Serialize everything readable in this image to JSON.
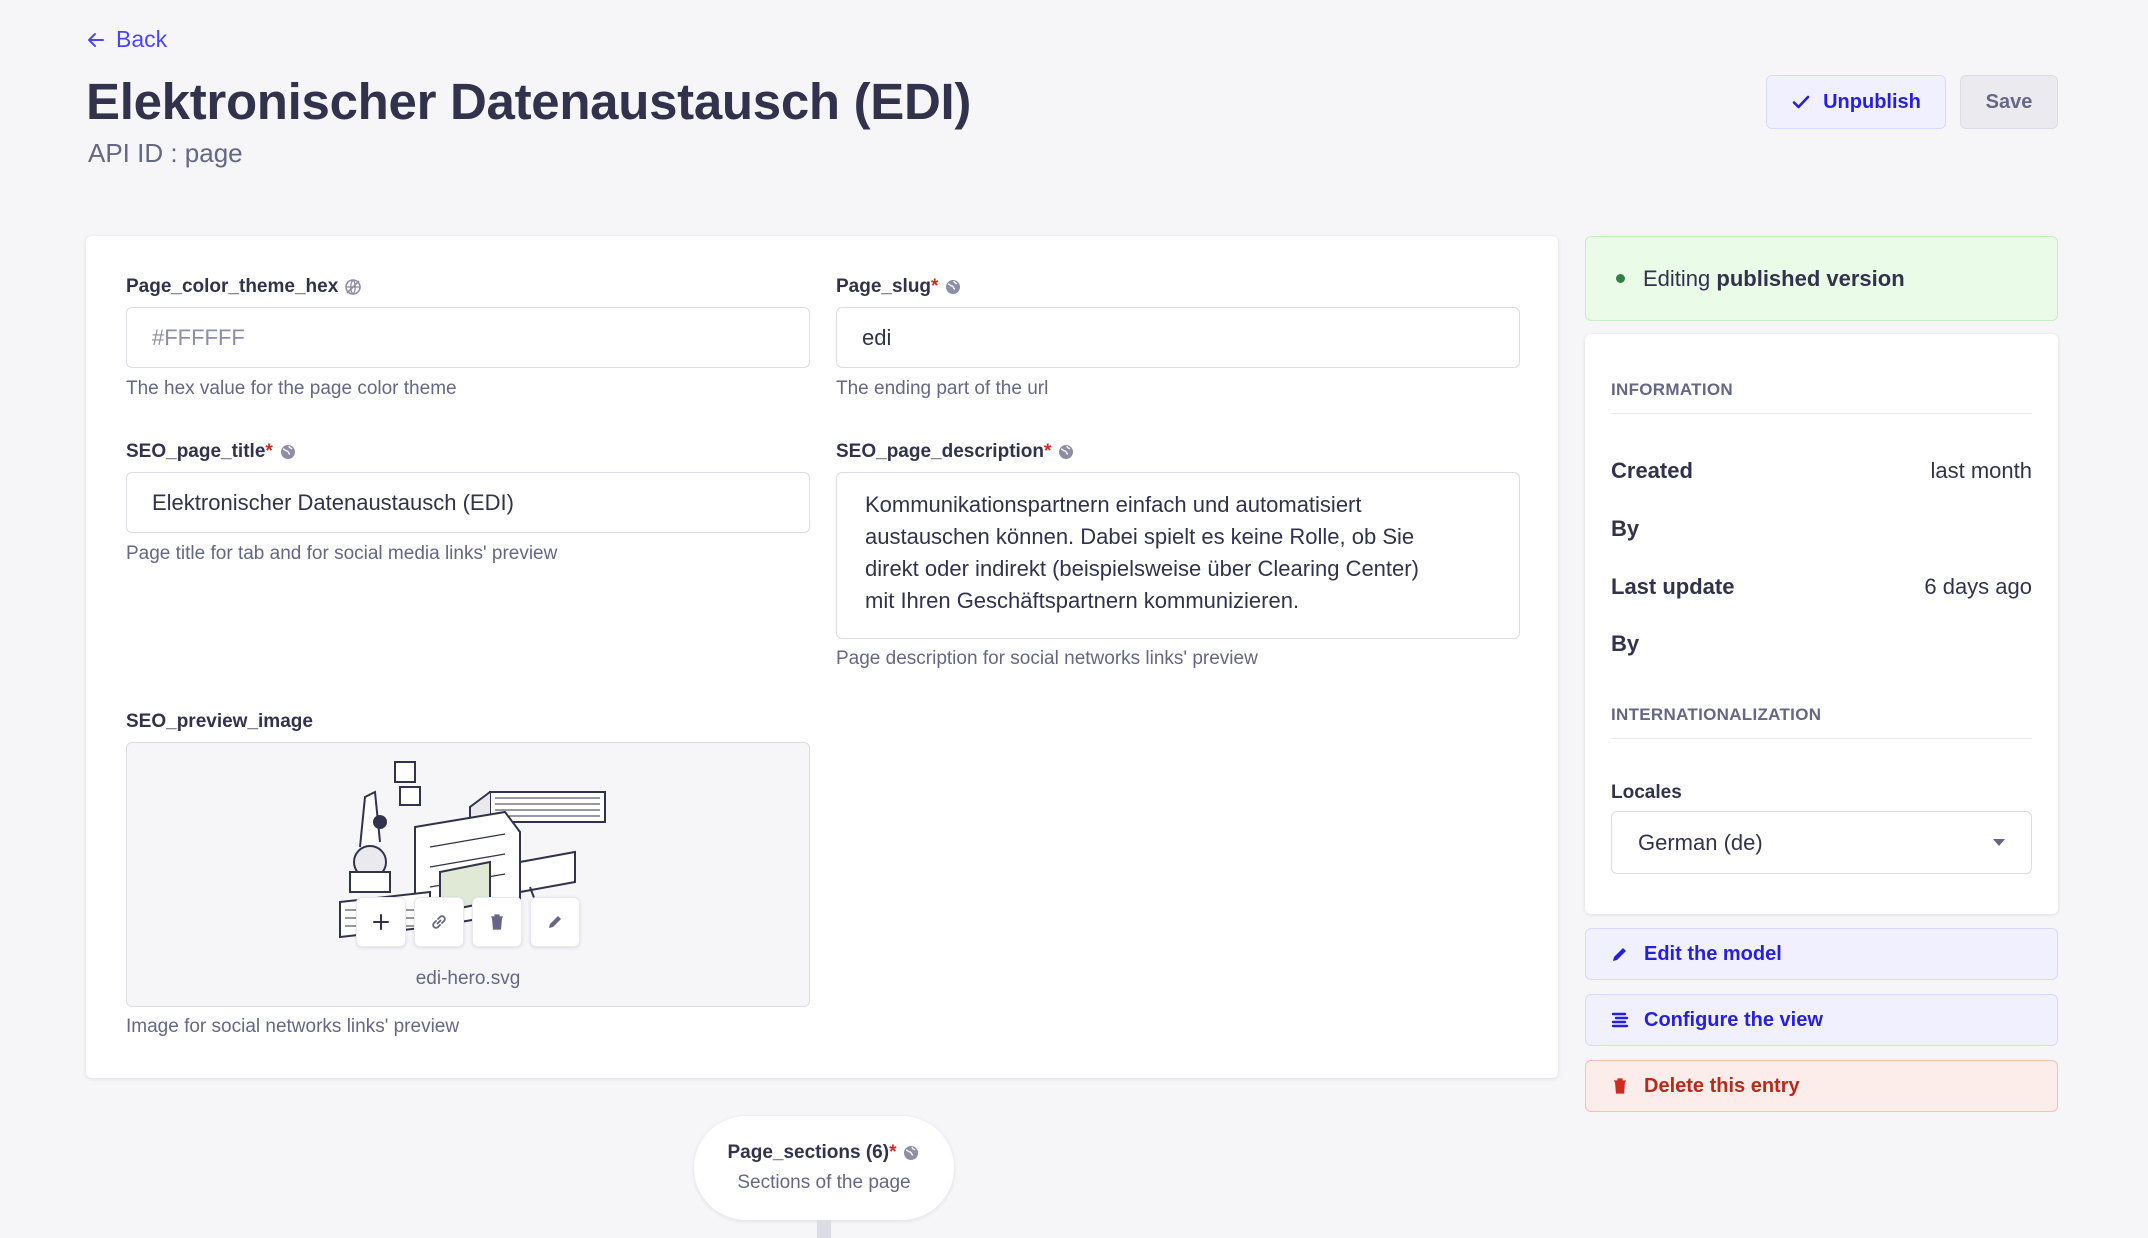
{
  "header": {
    "back_label": "Back",
    "title": "Elektronischer Datenaustausch (EDI)",
    "api_id": "API ID : page",
    "unpublish_label": "Unpublish",
    "save_label": "Save"
  },
  "fields": {
    "color_theme": {
      "label": "Page_color_theme_hex",
      "placeholder": "#FFFFFF",
      "hint": "The hex value for the page color theme"
    },
    "slug": {
      "label": "Page_slug",
      "required_mark": "*",
      "value": "edi",
      "hint": "The ending part of the url"
    },
    "seo_title": {
      "label": "SEO_page_title",
      "required_mark": "*",
      "value": "Elektronischer Datenaustausch (EDI)",
      "hint": "Page title for tab and for social media links' preview"
    },
    "seo_description": {
      "label": "SEO_page_description",
      "required_mark": "*",
      "value": "Kommunikationspartnern einfach und automatisiert\naustauschen können. Dabei spielt es keine Rolle, ob Sie\ndirekt oder indirekt (beispielsweise über Clearing Center)\nmit Ihren Geschäftspartnern kommunizieren.",
      "hint": "Page description for social networks links' preview"
    },
    "seo_image": {
      "label": "SEO_preview_image",
      "filename": "edi-hero.svg",
      "hint": "Image for social networks links' preview",
      "actions": [
        "plus-icon",
        "link-icon",
        "trash-icon",
        "pencil-icon"
      ]
    }
  },
  "sidebar": {
    "status_prefix": "Editing ",
    "status_bold": "published version",
    "information_title": "INFORMATION",
    "info_rows": [
      {
        "key": "Created",
        "value": "last month"
      },
      {
        "key": "By",
        "value": ""
      },
      {
        "key": "Last update",
        "value": "6 days ago"
      },
      {
        "key": "By",
        "value": ""
      }
    ],
    "i18n_title": "INTERNATIONALIZATION",
    "locales_label": "Locales",
    "locale_value": "German (de)",
    "edit_model_label": "Edit the model",
    "configure_view_label": "Configure the view",
    "delete_entry_label": "Delete this entry"
  },
  "dynamic_zone": {
    "title": "Page_sections (6)",
    "required_mark": "*",
    "subtitle": "Sections of the page"
  },
  "colors": {
    "primary": "#4945ff",
    "danger": "#d02b20",
    "success_bg": "#eafbe7",
    "background": "#f6f6f9"
  }
}
